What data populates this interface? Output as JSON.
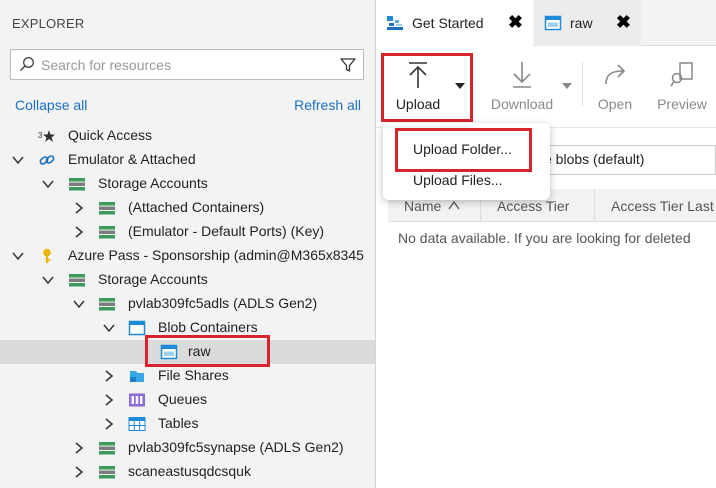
{
  "explorer": {
    "title": "EXPLORER",
    "search_placeholder": "Search for resources",
    "collapse_all": "Collapse all",
    "refresh_all": "Refresh all",
    "tree": {
      "quick_access": "Quick Access",
      "emulator_attached": "Emulator & Attached",
      "storage_accounts_1": "Storage Accounts",
      "attached_containers": "(Attached Containers)",
      "emulator_default": "(Emulator - Default Ports) (Key)",
      "azure_pass": "Azure Pass - Sponsorship (admin@M365x8345",
      "storage_accounts_2": "Storage Accounts",
      "adls_account": "pvlab309fc5adls (ADLS Gen2)",
      "blob_containers": "Blob Containers",
      "raw": "raw",
      "file_shares": "File Shares",
      "queues": "Queues",
      "tables": "Tables",
      "synapse_account": "pvlab309fc5synapse (ADLS Gen2)",
      "scane_account": "scaneastusqdcsquk"
    }
  },
  "tabs": [
    {
      "label": "Get Started",
      "icon": "get-started-icon",
      "close": "✖"
    },
    {
      "label": "raw",
      "icon": "container-icon",
      "close": "✖"
    }
  ],
  "toolbar": {
    "upload": "Upload",
    "download": "Download",
    "open": "Open",
    "preview": "Preview"
  },
  "upload_menu": {
    "folder": "Upload Folder...",
    "files": "Upload Files..."
  },
  "view_select": "ve blobs (default)",
  "grid": {
    "columns": [
      "Name",
      "Access Tier",
      "Access Tier Last"
    ],
    "empty_message": "No data available. If you are looking for deleted"
  },
  "colors": {
    "accent_link": "#1a6fc4",
    "highlight": "#d9232a",
    "storage_green": "#3c9a5f",
    "container_blue": "#1f8ad8",
    "key_yellow": "#e8b500"
  }
}
